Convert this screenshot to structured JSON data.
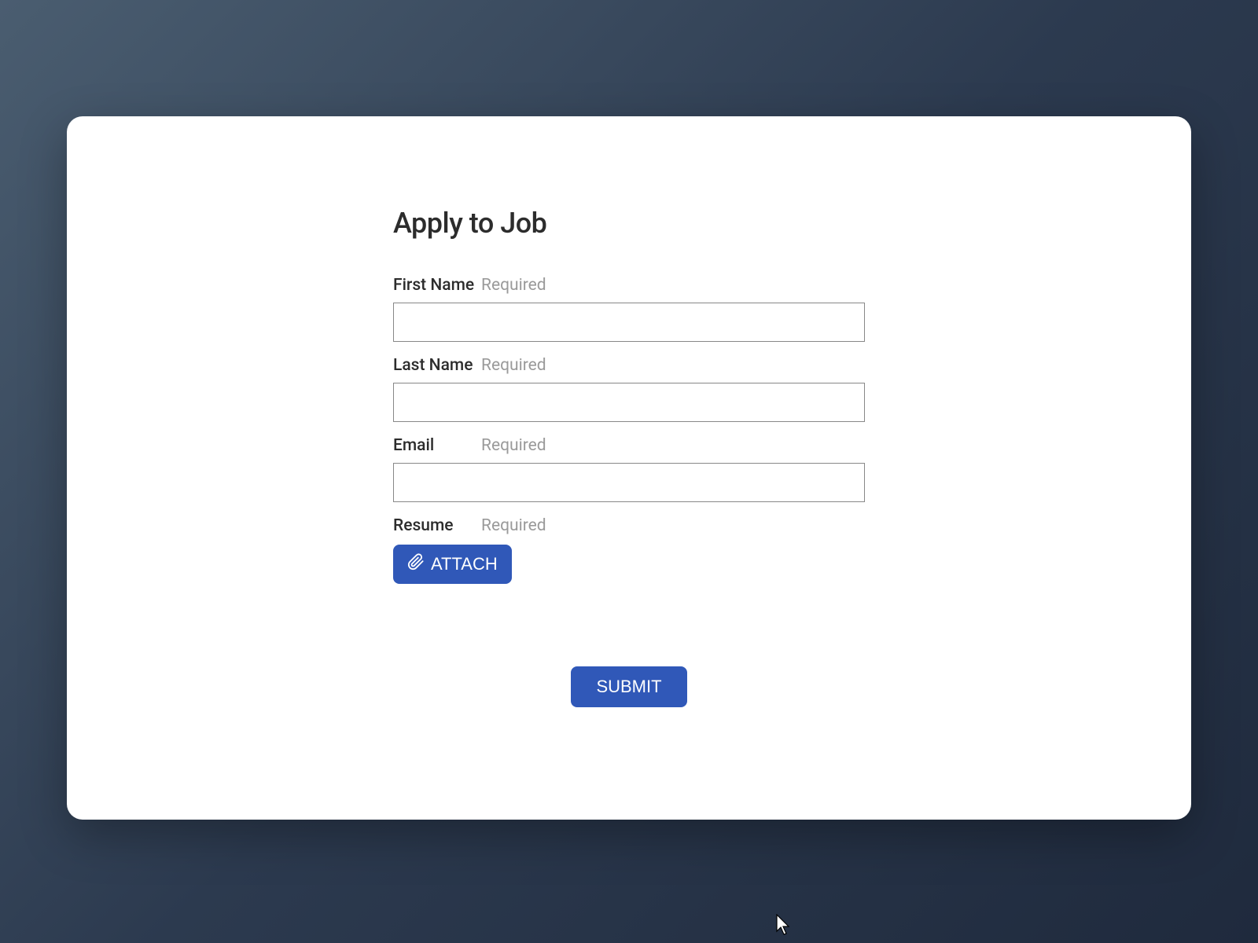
{
  "form": {
    "title": "Apply to Job",
    "fields": {
      "first_name": {
        "label": "First Name",
        "required_text": "Required",
        "value": ""
      },
      "last_name": {
        "label": "Last Name",
        "required_text": "Required",
        "value": ""
      },
      "email": {
        "label": "Email",
        "required_text": "Required",
        "value": ""
      },
      "resume": {
        "label": "Resume",
        "required_text": "Required",
        "attach_button_label": "ATTACH"
      }
    },
    "submit_label": "SUBMIT"
  },
  "colors": {
    "primary": "#3058b8",
    "text": "#2c2c2c",
    "muted": "#9a9a9a"
  }
}
